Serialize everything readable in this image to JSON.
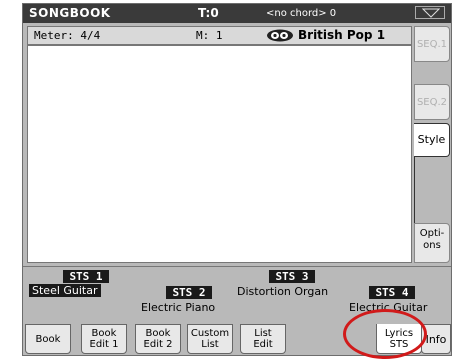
{
  "header": {
    "title": "SONGBOOK",
    "tempo": "T:0",
    "chord": "<no chord> 0"
  },
  "info": {
    "meter": "Meter:  4/4",
    "measure": "M:  1",
    "style_name": "British Pop 1"
  },
  "side_tabs": {
    "seq1": "SEQ.1",
    "seq2": "SEQ.2",
    "style": "Style",
    "options_line1": "Opti-",
    "options_line2": "ons"
  },
  "sts": {
    "items": [
      {
        "badge": "STS 1",
        "name": "Steel Guitar"
      },
      {
        "badge": "STS 2",
        "name": "Electric Piano"
      },
      {
        "badge": "STS 3",
        "name": "Distortion Organ"
      },
      {
        "badge": "STS 4",
        "name": "Electric Guitar"
      }
    ]
  },
  "bottom_tabs": [
    {
      "line1": "Book",
      "line2": ""
    },
    {
      "line1": "Book",
      "line2": "Edit 1"
    },
    {
      "line1": "Book",
      "line2": "Edit 2"
    },
    {
      "line1": "Custom",
      "line2": "List"
    },
    {
      "line1": "List",
      "line2": "Edit"
    },
    {
      "line1": "Lyrics",
      "line2": "STS"
    },
    {
      "line1": "Info",
      "line2": ""
    }
  ],
  "colors": {
    "highlight_circle": "#d11a1a",
    "title_bar": "#3a3a3a",
    "panel": "#b9b9b9"
  }
}
